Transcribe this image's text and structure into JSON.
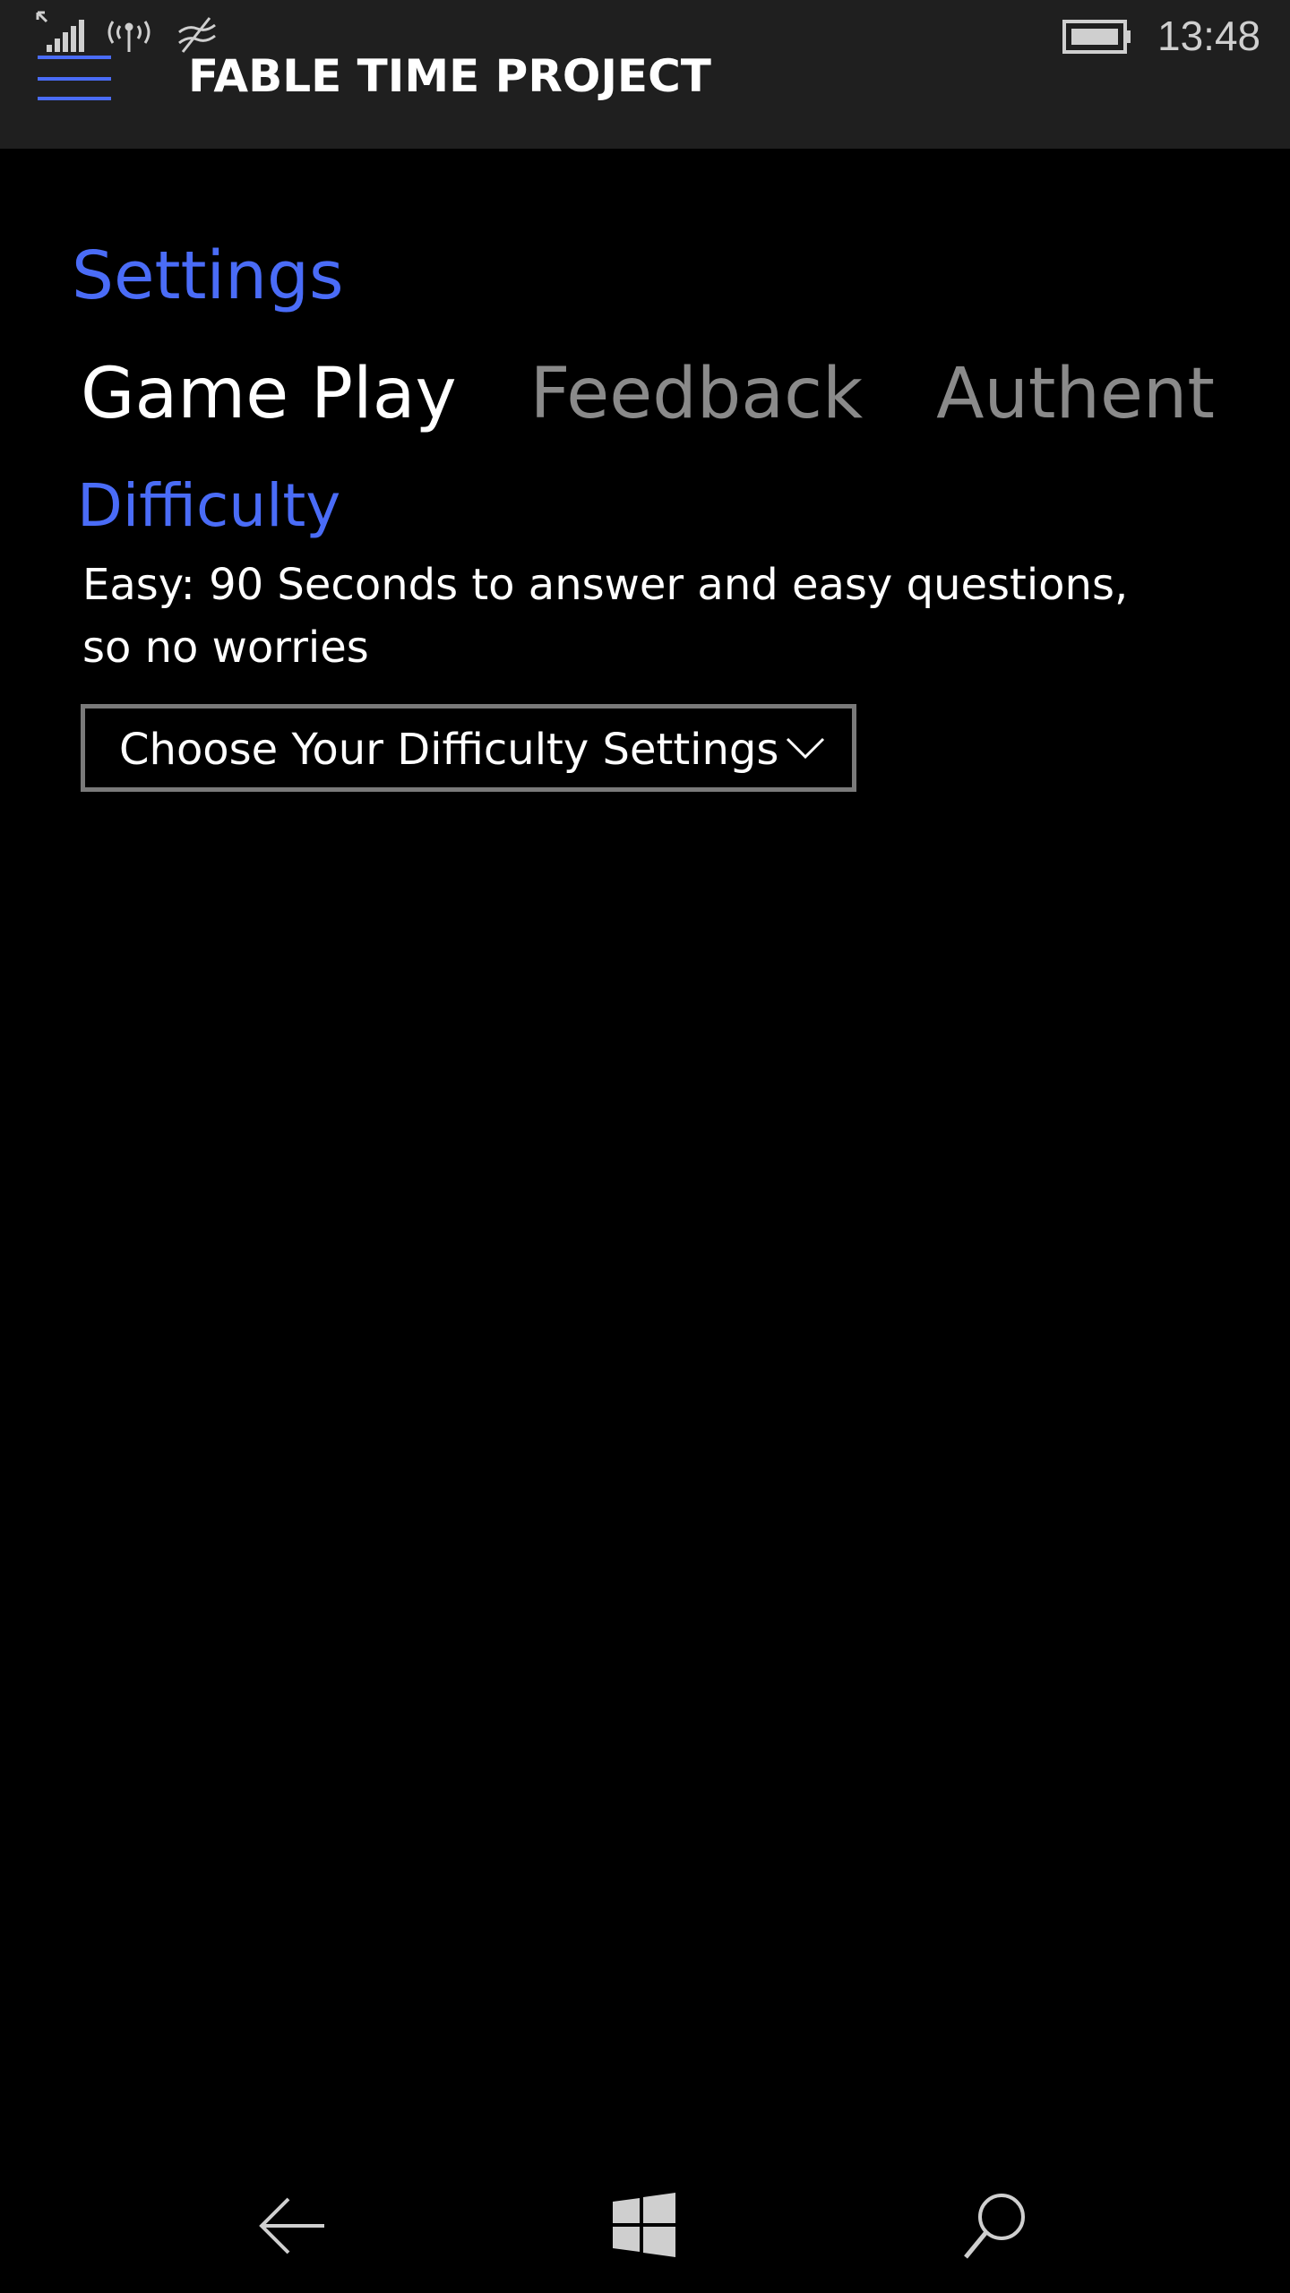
{
  "status_bar": {
    "time": "13:48",
    "icons": [
      "signal-icon",
      "wifi-calling-icon",
      "network-icon",
      "battery-icon"
    ]
  },
  "header": {
    "menu_icon": "hamburger-icon",
    "app_title": "FABLE TIME PROJECT"
  },
  "page": {
    "title": "Settings",
    "tabs": [
      {
        "label": "Game Play",
        "active": true
      },
      {
        "label": "Feedback",
        "active": false
      },
      {
        "label": "Authentica",
        "active": false
      }
    ],
    "section_heading": "Difficulty",
    "description": "Easy: 90 Seconds to answer and easy questions, so no worries",
    "dropdown": {
      "selected": "Choose Your Difficulty Settings",
      "icon": "chevron-down-icon"
    }
  },
  "nav_bar": {
    "icons": [
      "back-arrow-icon",
      "windows-start-icon",
      "search-icon"
    ]
  },
  "colors": {
    "accent": "#4a6cf7",
    "header_bg": "#1f1f1f",
    "background": "#000000",
    "inactive_text": "#8a8a8a",
    "border": "#7a7a7a"
  }
}
